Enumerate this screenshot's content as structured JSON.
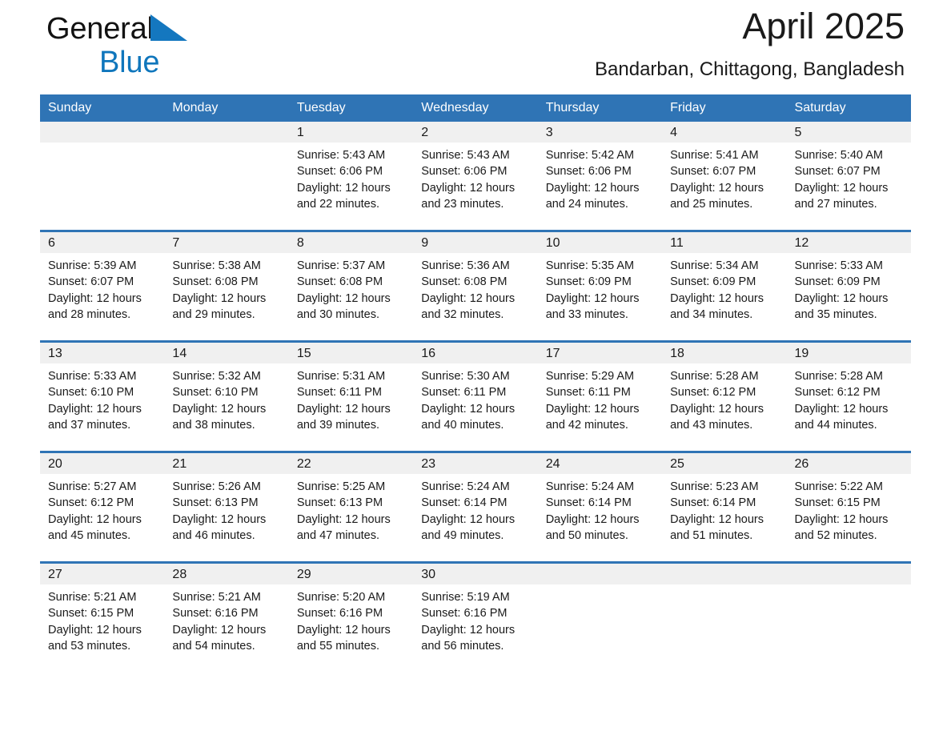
{
  "brand": {
    "name_part1": "General",
    "name_part2": "Blue",
    "triangle_color": "#1477bf",
    "text_color": "#121212"
  },
  "header": {
    "title": "April 2025",
    "subtitle": "Bandarban, Chittagong, Bangladesh",
    "accent_color": "#2f74b5",
    "datebar_color": "#f0f0f0"
  },
  "weekdays": [
    "Sunday",
    "Monday",
    "Tuesday",
    "Wednesday",
    "Thursday",
    "Friday",
    "Saturday"
  ],
  "weeks": [
    [
      {
        "date": "",
        "sunrise": "",
        "sunset": "",
        "daylight_line1": "",
        "daylight_line2": ""
      },
      {
        "date": "",
        "sunrise": "",
        "sunset": "",
        "daylight_line1": "",
        "daylight_line2": ""
      },
      {
        "date": "1",
        "sunrise": "Sunrise: 5:43 AM",
        "sunset": "Sunset: 6:06 PM",
        "daylight_line1": "Daylight: 12 hours",
        "daylight_line2": "and 22 minutes."
      },
      {
        "date": "2",
        "sunrise": "Sunrise: 5:43 AM",
        "sunset": "Sunset: 6:06 PM",
        "daylight_line1": "Daylight: 12 hours",
        "daylight_line2": "and 23 minutes."
      },
      {
        "date": "3",
        "sunrise": "Sunrise: 5:42 AM",
        "sunset": "Sunset: 6:06 PM",
        "daylight_line1": "Daylight: 12 hours",
        "daylight_line2": "and 24 minutes."
      },
      {
        "date": "4",
        "sunrise": "Sunrise: 5:41 AM",
        "sunset": "Sunset: 6:07 PM",
        "daylight_line1": "Daylight: 12 hours",
        "daylight_line2": "and 25 minutes."
      },
      {
        "date": "5",
        "sunrise": "Sunrise: 5:40 AM",
        "sunset": "Sunset: 6:07 PM",
        "daylight_line1": "Daylight: 12 hours",
        "daylight_line2": "and 27 minutes."
      }
    ],
    [
      {
        "date": "6",
        "sunrise": "Sunrise: 5:39 AM",
        "sunset": "Sunset: 6:07 PM",
        "daylight_line1": "Daylight: 12 hours",
        "daylight_line2": "and 28 minutes."
      },
      {
        "date": "7",
        "sunrise": "Sunrise: 5:38 AM",
        "sunset": "Sunset: 6:08 PM",
        "daylight_line1": "Daylight: 12 hours",
        "daylight_line2": "and 29 minutes."
      },
      {
        "date": "8",
        "sunrise": "Sunrise: 5:37 AM",
        "sunset": "Sunset: 6:08 PM",
        "daylight_line1": "Daylight: 12 hours",
        "daylight_line2": "and 30 minutes."
      },
      {
        "date": "9",
        "sunrise": "Sunrise: 5:36 AM",
        "sunset": "Sunset: 6:08 PM",
        "daylight_line1": "Daylight: 12 hours",
        "daylight_line2": "and 32 minutes."
      },
      {
        "date": "10",
        "sunrise": "Sunrise: 5:35 AM",
        "sunset": "Sunset: 6:09 PM",
        "daylight_line1": "Daylight: 12 hours",
        "daylight_line2": "and 33 minutes."
      },
      {
        "date": "11",
        "sunrise": "Sunrise: 5:34 AM",
        "sunset": "Sunset: 6:09 PM",
        "daylight_line1": "Daylight: 12 hours",
        "daylight_line2": "and 34 minutes."
      },
      {
        "date": "12",
        "sunrise": "Sunrise: 5:33 AM",
        "sunset": "Sunset: 6:09 PM",
        "daylight_line1": "Daylight: 12 hours",
        "daylight_line2": "and 35 minutes."
      }
    ],
    [
      {
        "date": "13",
        "sunrise": "Sunrise: 5:33 AM",
        "sunset": "Sunset: 6:10 PM",
        "daylight_line1": "Daylight: 12 hours",
        "daylight_line2": "and 37 minutes."
      },
      {
        "date": "14",
        "sunrise": "Sunrise: 5:32 AM",
        "sunset": "Sunset: 6:10 PM",
        "daylight_line1": "Daylight: 12 hours",
        "daylight_line2": "and 38 minutes."
      },
      {
        "date": "15",
        "sunrise": "Sunrise: 5:31 AM",
        "sunset": "Sunset: 6:11 PM",
        "daylight_line1": "Daylight: 12 hours",
        "daylight_line2": "and 39 minutes."
      },
      {
        "date": "16",
        "sunrise": "Sunrise: 5:30 AM",
        "sunset": "Sunset: 6:11 PM",
        "daylight_line1": "Daylight: 12 hours",
        "daylight_line2": "and 40 minutes."
      },
      {
        "date": "17",
        "sunrise": "Sunrise: 5:29 AM",
        "sunset": "Sunset: 6:11 PM",
        "daylight_line1": "Daylight: 12 hours",
        "daylight_line2": "and 42 minutes."
      },
      {
        "date": "18",
        "sunrise": "Sunrise: 5:28 AM",
        "sunset": "Sunset: 6:12 PM",
        "daylight_line1": "Daylight: 12 hours",
        "daylight_line2": "and 43 minutes."
      },
      {
        "date": "19",
        "sunrise": "Sunrise: 5:28 AM",
        "sunset": "Sunset: 6:12 PM",
        "daylight_line1": "Daylight: 12 hours",
        "daylight_line2": "and 44 minutes."
      }
    ],
    [
      {
        "date": "20",
        "sunrise": "Sunrise: 5:27 AM",
        "sunset": "Sunset: 6:12 PM",
        "daylight_line1": "Daylight: 12 hours",
        "daylight_line2": "and 45 minutes."
      },
      {
        "date": "21",
        "sunrise": "Sunrise: 5:26 AM",
        "sunset": "Sunset: 6:13 PM",
        "daylight_line1": "Daylight: 12 hours",
        "daylight_line2": "and 46 minutes."
      },
      {
        "date": "22",
        "sunrise": "Sunrise: 5:25 AM",
        "sunset": "Sunset: 6:13 PM",
        "daylight_line1": "Daylight: 12 hours",
        "daylight_line2": "and 47 minutes."
      },
      {
        "date": "23",
        "sunrise": "Sunrise: 5:24 AM",
        "sunset": "Sunset: 6:14 PM",
        "daylight_line1": "Daylight: 12 hours",
        "daylight_line2": "and 49 minutes."
      },
      {
        "date": "24",
        "sunrise": "Sunrise: 5:24 AM",
        "sunset": "Sunset: 6:14 PM",
        "daylight_line1": "Daylight: 12 hours",
        "daylight_line2": "and 50 minutes."
      },
      {
        "date": "25",
        "sunrise": "Sunrise: 5:23 AM",
        "sunset": "Sunset: 6:14 PM",
        "daylight_line1": "Daylight: 12 hours",
        "daylight_line2": "and 51 minutes."
      },
      {
        "date": "26",
        "sunrise": "Sunrise: 5:22 AM",
        "sunset": "Sunset: 6:15 PM",
        "daylight_line1": "Daylight: 12 hours",
        "daylight_line2": "and 52 minutes."
      }
    ],
    [
      {
        "date": "27",
        "sunrise": "Sunrise: 5:21 AM",
        "sunset": "Sunset: 6:15 PM",
        "daylight_line1": "Daylight: 12 hours",
        "daylight_line2": "and 53 minutes."
      },
      {
        "date": "28",
        "sunrise": "Sunrise: 5:21 AM",
        "sunset": "Sunset: 6:16 PM",
        "daylight_line1": "Daylight: 12 hours",
        "daylight_line2": "and 54 minutes."
      },
      {
        "date": "29",
        "sunrise": "Sunrise: 5:20 AM",
        "sunset": "Sunset: 6:16 PM",
        "daylight_line1": "Daylight: 12 hours",
        "daylight_line2": "and 55 minutes."
      },
      {
        "date": "30",
        "sunrise": "Sunrise: 5:19 AM",
        "sunset": "Sunset: 6:16 PM",
        "daylight_line1": "Daylight: 12 hours",
        "daylight_line2": "and 56 minutes."
      },
      {
        "date": "",
        "sunrise": "",
        "sunset": "",
        "daylight_line1": "",
        "daylight_line2": ""
      },
      {
        "date": "",
        "sunrise": "",
        "sunset": "",
        "daylight_line1": "",
        "daylight_line2": ""
      },
      {
        "date": "",
        "sunrise": "",
        "sunset": "",
        "daylight_line1": "",
        "daylight_line2": ""
      }
    ]
  ]
}
